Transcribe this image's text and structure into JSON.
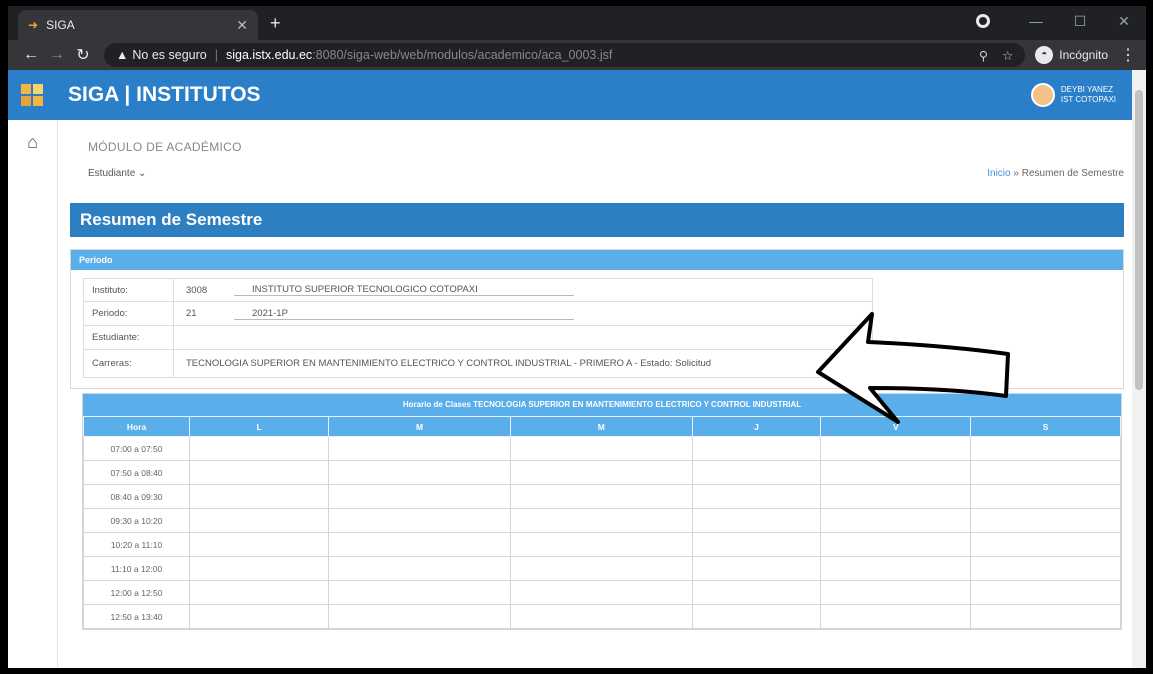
{
  "browser": {
    "tab_title": "SIGA",
    "url_warning": "No es seguro",
    "url_host": "siga.istx.edu.ec",
    "url_path": ":8080/siga-web/web/modulos/academico/aca_0003.jsf",
    "incognito_label": "Incógnito"
  },
  "app": {
    "title": "SIGA | INSTITUTOS",
    "user_name": "DEYBI YANEZ",
    "user_org": "IST COTOPAXI"
  },
  "module": {
    "title": "MÓDULO DE ACADÉMICO",
    "menu_label": "Estudiante ⌄",
    "breadcrumb_home": "Inicio",
    "breadcrumb_current": "Resumen de Semestre"
  },
  "section": {
    "title": "Resumen de Semestre",
    "periodo_header": "Periodo"
  },
  "form": {
    "instituto_label": "Instituto:",
    "instituto_code": "3008",
    "instituto_name": "INSTITUTO SUPERIOR TECNOLOGICO COTOPAXI",
    "periodo_label": "Periodo:",
    "periodo_code": "21",
    "periodo_name": "2021-1P",
    "estudiante_label": "Estudiante:",
    "carrera_label": "Carreras:",
    "carrera_value": "TECNOLOGIA SUPERIOR EN MANTENIMIENTO ELECTRICO Y CONTROL INDUSTRIAL - PRIMERO A - Estado: Solicitud"
  },
  "schedule": {
    "title": "Horario de Clases TECNOLOGIA SUPERIOR EN MANTENIMIENTO ELECTRICO Y CONTROL INDUSTRIAL",
    "headers": [
      "Hora",
      "L",
      "M",
      "M",
      "J",
      "V",
      "S"
    ],
    "hours": [
      "07:00 a 07:50",
      "07:50 a 08:40",
      "08:40 a 09:30",
      "09:30 a 10:20",
      "10:20 a 11:10",
      "11:10 a 12:00",
      "12:00 a 12:50",
      "12:50 a 13:40"
    ]
  }
}
